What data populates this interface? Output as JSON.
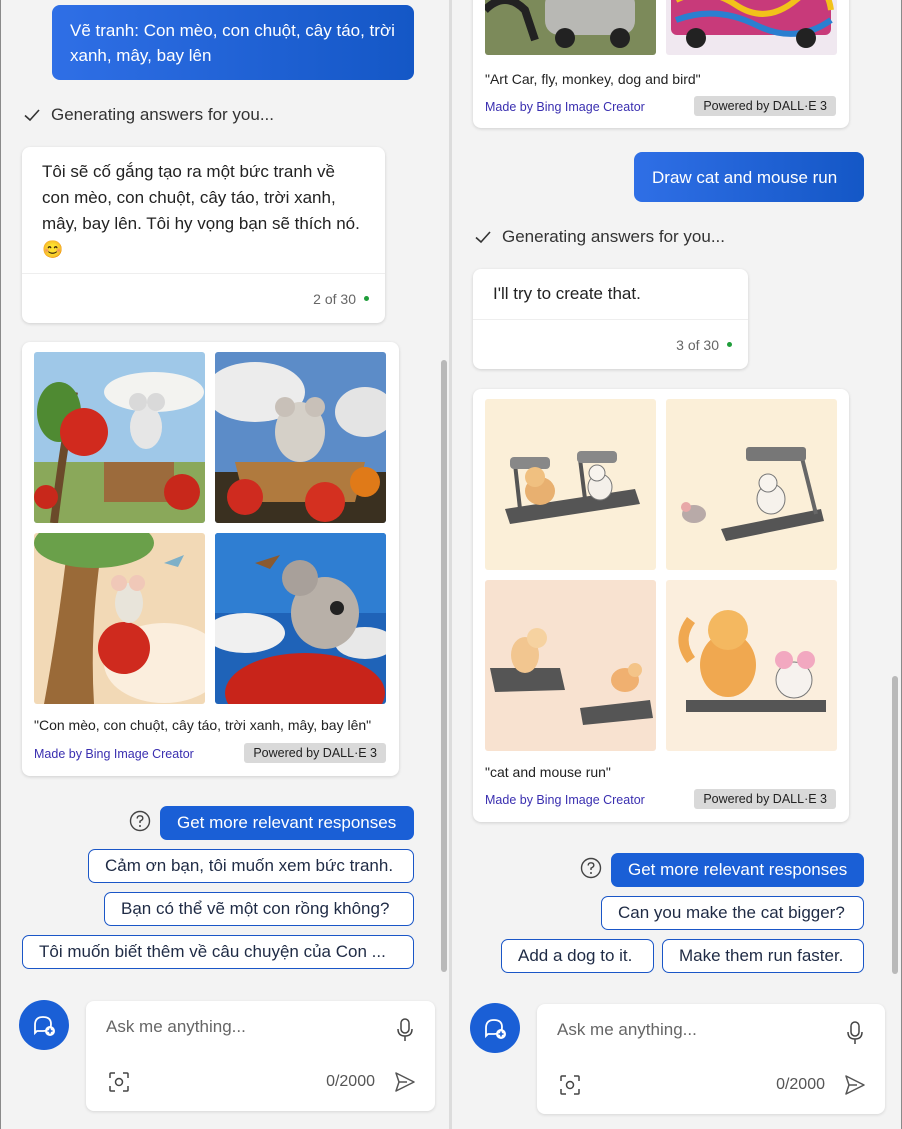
{
  "left": {
    "user_message": "Vẽ tranh: Con mèo, con chuột, cây táo, trời xanh, mây, bay lên",
    "generating": "Generating answers for you...",
    "reply": {
      "text": "Tôi sẽ cố gắng tạo ra một bức tranh về con mèo, con chuột, cây táo, trời xanh, mây, bay lên. Tôi hy vọng bạn sẽ thích nó. 😊",
      "counter": "2 of 30"
    },
    "image_card": {
      "caption": "\"Con mèo, con chuột, cây táo, trời xanh, mây, bay lên\"",
      "made_by": "Made by Bing Image Creator",
      "powered": "Powered by DALL·E 3",
      "images": [
        "mouse-with-apple-tree-image",
        "mouse-in-basket-image",
        "mouse-on-branch-image",
        "mouse-on-apple-image"
      ]
    },
    "suggestions": {
      "primary": "Get more relevant responses",
      "items": [
        "Cảm ơn bạn, tôi muốn xem bức tranh.",
        "Bạn có thể vẽ một con rồng không?",
        "Tôi muốn biết thêm về câu chuyện của Con ..."
      ]
    },
    "input": {
      "placeholder": "Ask me anything...",
      "counter": "0/2000"
    }
  },
  "right": {
    "prev_card": {
      "caption": "\"Art Car, fly, monkey, dog and bird\"",
      "made_by": "Made by Bing Image Creator",
      "powered": "Powered by DALL·E 3"
    },
    "user_message": "Draw cat and mouse run",
    "generating": "Generating answers for you...",
    "reply": {
      "text": "I'll try to create that.",
      "counter": "3 of 30"
    },
    "image_card": {
      "caption": "\"cat and mouse run\"",
      "made_by": "Made by Bing Image Creator",
      "powered": "Powered by DALL·E 3",
      "images": [
        "cat-mouse-treadmill-1-image",
        "cat-mouse-treadmill-2-image",
        "cat-mouse-treadmill-3-image",
        "cat-mouse-treadmill-4-image"
      ]
    },
    "suggestions": {
      "primary": "Get more relevant responses",
      "items": [
        "Can you make the cat bigger?",
        "Add a dog to it.",
        "Make them run faster."
      ]
    },
    "input": {
      "placeholder": "Ask me anything...",
      "counter": "0/2000"
    }
  },
  "colors": {
    "accent": "#1a5fd6",
    "link": "#3a2fb0",
    "status_dot": "#1f9d3a"
  }
}
